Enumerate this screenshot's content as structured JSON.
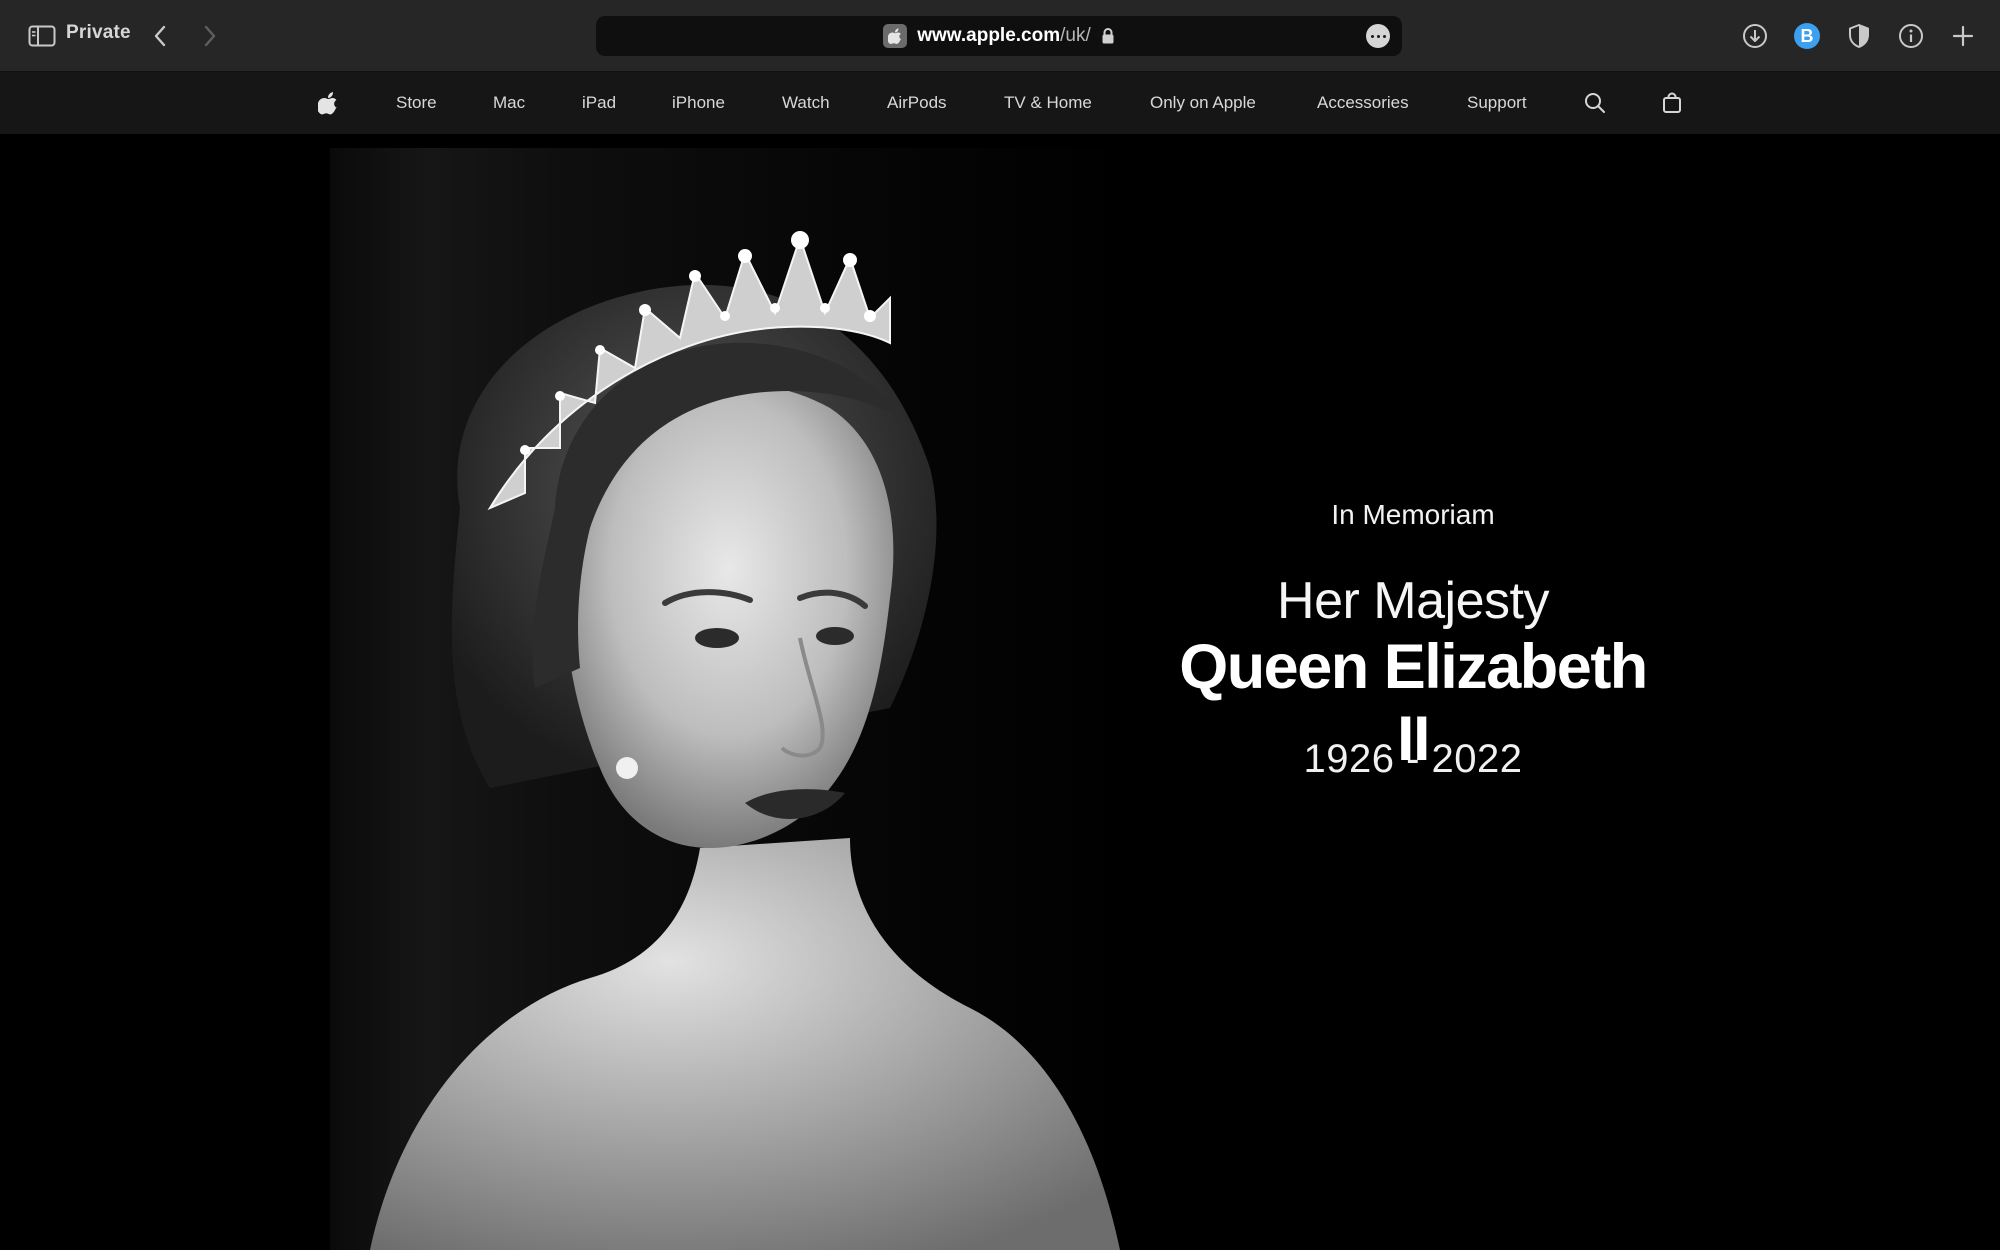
{
  "browser": {
    "private_label": "Private",
    "url_host": "www.apple.com",
    "url_path": "/uk/",
    "profile_badge": "B",
    "icons": {
      "sidebar": "sidebar-icon",
      "back": "chevron-left-icon",
      "forward": "chevron-right-icon",
      "lock": "lock-icon",
      "page_menu": "more-icon",
      "downloads": "download-icon",
      "privacy": "shield-icon",
      "info": "info-icon",
      "new_tab": "plus-icon"
    },
    "colors": {
      "toolbar": "#262626",
      "address_bar": "#0f0f0f",
      "badge": "#3aa0ef"
    }
  },
  "nav": {
    "items": [
      "Store",
      "Mac",
      "iPad",
      "iPhone",
      "Watch",
      "AirPods",
      "TV & Home",
      "Only on Apple",
      "Accessories",
      "Support"
    ],
    "icons": {
      "logo": "apple-logo-icon",
      "search": "search-icon",
      "bag": "bag-icon"
    },
    "background": "#161616"
  },
  "hero": {
    "eyebrow": "In Memoriam",
    "title_line1": "Her Majesty",
    "title_line2": "Queen Elizabeth II",
    "years": "1926 - 2022",
    "image": "black-and-white-portrait"
  }
}
